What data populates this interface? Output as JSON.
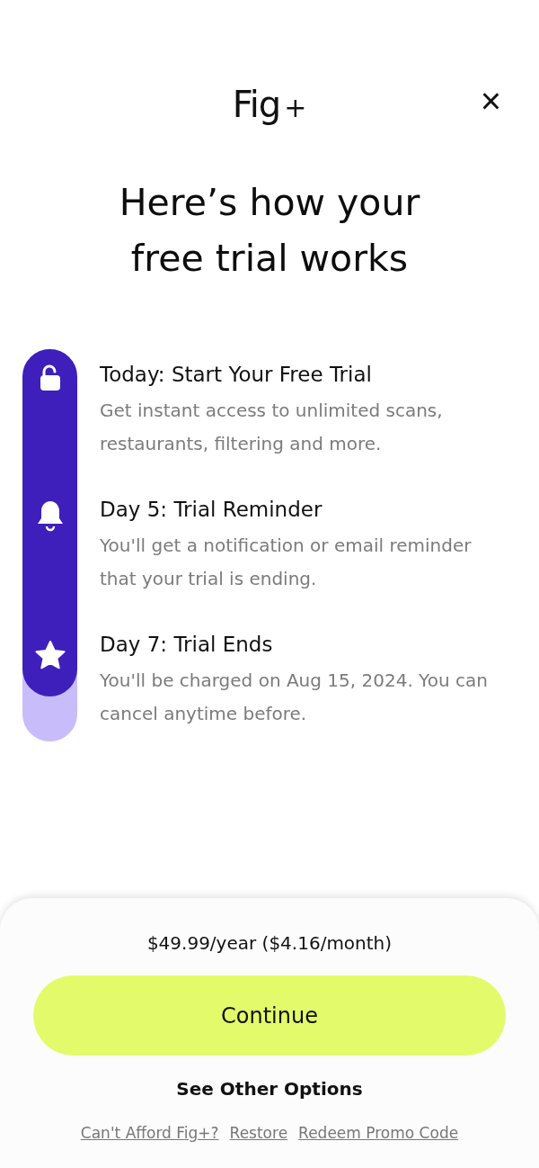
{
  "header": {
    "logo": "Fig",
    "logo_suffix": "+",
    "close": "×"
  },
  "title": "Here’s how your free trial works",
  "timeline": {
    "level": 0.885
  },
  "steps": [
    {
      "kind": "lock",
      "title": "Today: Start Your Free Trial",
      "description": "Get instant access to unlimited scans, restaurants, filtering and more."
    },
    {
      "kind": "bell",
      "title": "Day 5: Trial Reminder",
      "description": "You'll get a notification or email reminder that your trial is ending."
    },
    {
      "kind": "star",
      "title": "Day 7: Trial Ends",
      "description": "You'll be charged on Aug 15, 2024. You can cancel anytime before."
    }
  ],
  "sheet": {
    "price": "$49.99/year ($4.16/month)",
    "button": "Continue",
    "other_options": "See Other Options",
    "links": [
      "Can't Afford Fig+?",
      "Restore",
      "Redeem Promo Code"
    ]
  }
}
